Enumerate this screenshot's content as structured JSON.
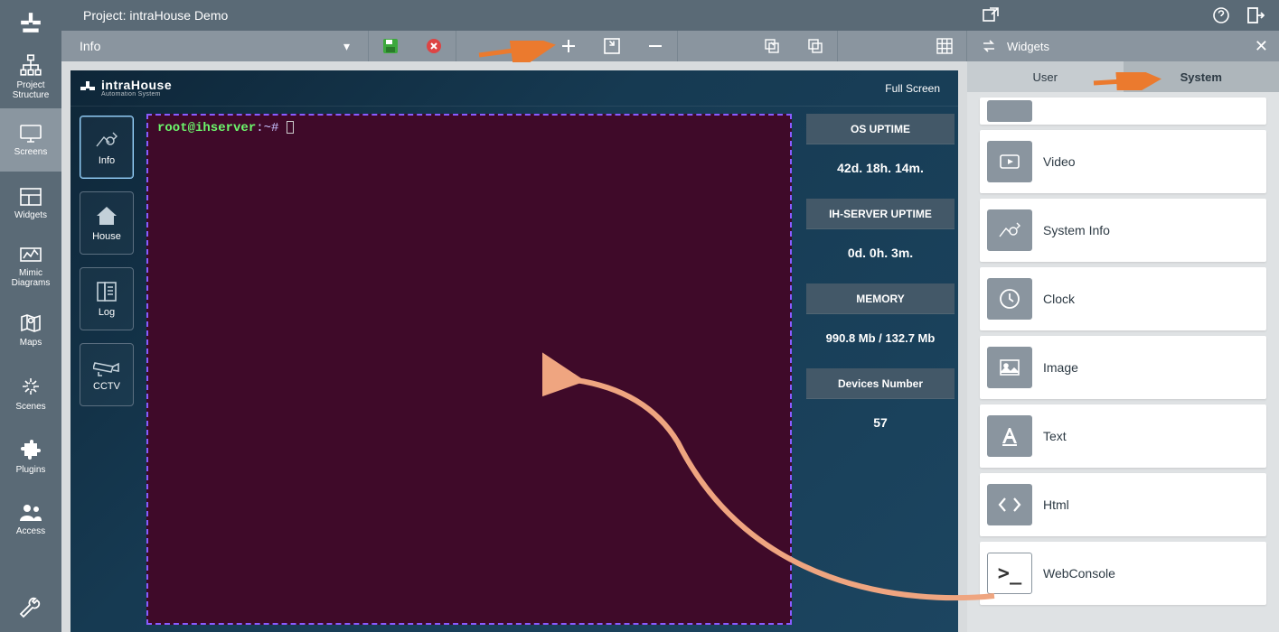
{
  "header": {
    "project_label": "Project: intraHouse Demo"
  },
  "toolbar": {
    "dropdown_value": "Info"
  },
  "left_nav": {
    "items": [
      {
        "label": "Project Structure"
      },
      {
        "label": "Screens"
      },
      {
        "label": "Widgets"
      },
      {
        "label": "Mimic Diagrams"
      },
      {
        "label": "Maps"
      },
      {
        "label": "Scenes"
      },
      {
        "label": "Plugins"
      },
      {
        "label": "Access"
      }
    ]
  },
  "preview": {
    "brand_name": "intraHouse",
    "brand_tag": "Automation System",
    "fullscreen_label": "Full Screen",
    "side_tabs": [
      {
        "label": "Info"
      },
      {
        "label": "House"
      },
      {
        "label": "Log"
      },
      {
        "label": "CCTV"
      }
    ],
    "console": {
      "user": "root@ihserver",
      "path": ":~#"
    },
    "stats": [
      {
        "title": "OS UPTIME",
        "value": "42d. 18h. 14m."
      },
      {
        "title": "IH-SERVER UPTIME",
        "value": "0d. 0h. 3m."
      },
      {
        "title": "MEMORY",
        "value": "990.8 Mb / 132.7 Mb"
      },
      {
        "title": "Devices Number",
        "value": "57"
      }
    ]
  },
  "right_panel": {
    "title": "Widgets",
    "tabs": [
      {
        "label": "User"
      },
      {
        "label": "System"
      }
    ],
    "items": [
      {
        "label": ""
      },
      {
        "label": "Video"
      },
      {
        "label": "System Info"
      },
      {
        "label": "Clock"
      },
      {
        "label": "Image"
      },
      {
        "label": "Text"
      },
      {
        "label": "Html"
      },
      {
        "label": "WebConsole"
      }
    ]
  }
}
